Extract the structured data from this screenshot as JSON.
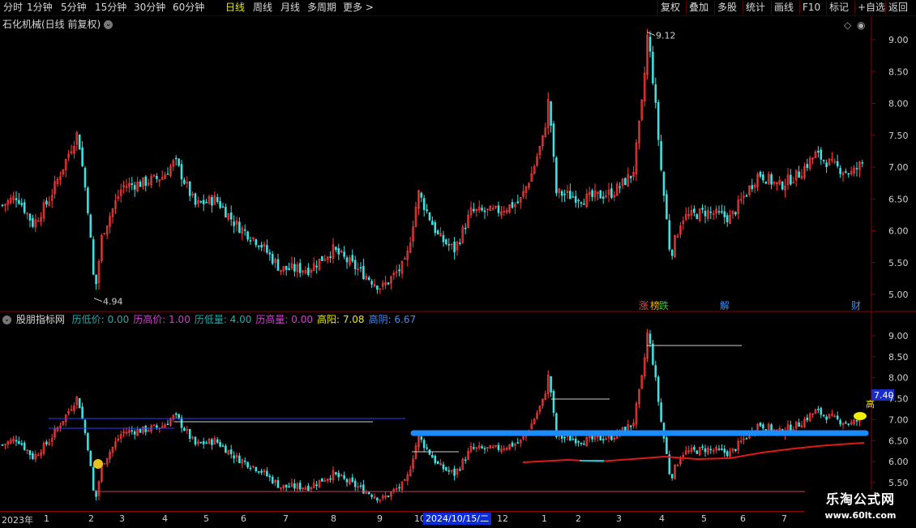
{
  "toolbar": {
    "left_items": [
      "分时",
      "1分钟",
      "5分钟",
      "15分钟",
      "30分钟",
      "60分钟",
      "日线",
      "周线",
      "月线",
      "多周期",
      "更多 >"
    ],
    "active_index": 6,
    "right_items": [
      "复权",
      "叠加",
      "多股",
      "统计",
      "画线",
      "F10",
      "标记",
      "+自选",
      "返回"
    ]
  },
  "main_chart": {
    "title": "石化机械(日线 前复权)",
    "high_label": "9.12",
    "low_label": "4.94",
    "y_ticks": [
      "9.00",
      "8.50",
      "8.00",
      "7.50",
      "7.00",
      "6.50",
      "6.00",
      "5.50",
      "5.00"
    ],
    "event_badges": [
      "涨",
      "榜",
      "跌",
      "解",
      "财"
    ]
  },
  "indicator": {
    "name": "股朋指标网",
    "fields": [
      {
        "label": "历低价:",
        "value": "0.00",
        "color": "#2aa8a8"
      },
      {
        "label": "历高价:",
        "value": "1.00",
        "color": "#d040d0"
      },
      {
        "label": "历低量:",
        "value": "4.00",
        "color": "#2aa8a8"
      },
      {
        "label": "历高量:",
        "value": "0.00",
        "color": "#d040d0"
      },
      {
        "label": "高阳:",
        "value": "7.08",
        "color": "#e8e800"
      },
      {
        "label": "高阴:",
        "value": "6.67",
        "color": "#4a8af0"
      }
    ],
    "y_ticks": [
      "9.00",
      "8.50",
      "8.00",
      "7.50",
      "7.00",
      "6.50",
      "6.00",
      "5.50"
    ],
    "price_tag": "7.40",
    "side_glyph": "高"
  },
  "date_axis": {
    "labels": [
      "2023年",
      "1",
      "2",
      "3",
      "4",
      "5",
      "6",
      "7",
      "8",
      "9",
      "10",
      "12",
      "1",
      "2",
      "3",
      "4",
      "5",
      "6",
      "7"
    ],
    "highlight": "2024/10/15/二"
  },
  "watermark": {
    "line1": "乐淘公式网",
    "line2": "www.60lt.com"
  },
  "colors": {
    "up": "#ff3c3c",
    "down": "#40e0e0",
    "axis": "#8a0000",
    "band": "#1a8cff"
  }
}
